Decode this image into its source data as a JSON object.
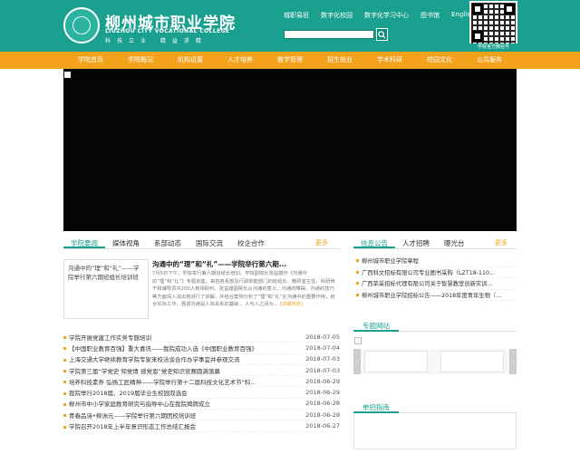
{
  "header": {
    "title_cn": "柳州城市职业学院",
    "title_en": "LIUZHOU CITY VOCATIONAL COLLEGE",
    "motto": "科技立业 精益求精",
    "top_links": [
      "城职易班",
      "数字化校园",
      "数字化学习中心",
      "图书馆",
      "English"
    ],
    "search": {
      "value": "",
      "placeholder": ""
    },
    "qr_caption": "学院官方微信号"
  },
  "nav": [
    "学院首页",
    "学院概况",
    "机构设置",
    "人才培养",
    "教学管理",
    "招生就业",
    "学术科研",
    "校园文化",
    "公共服务"
  ],
  "news_section": {
    "tabs": [
      "学院要闻",
      "媒体视角",
      "系部动态",
      "国际交流",
      "校企合作"
    ],
    "more": "更多",
    "featured": {
      "box_text": "沟通中的“理”和“礼”——学院举行第六期班组长培训班",
      "title": "沟通中的“理”和“礼”——学院举行第六期...",
      "body": "7月5日下午，学院举行第六期班组长培训，学院副院长张益雄作《沟通中的“理”和“礼”》专题讲座。来自各系部及行政职能部门的班组长、教研室主任、科研骨干和辅导员共200人到场聆听。张益雄副院长从沟通的意义、沟通的障碍、沟通的技巧等方面深入浅出地进行了讲解，并结合案例分析了“理”和“礼”在沟通中的重要作用，结合实际工作，强调沟通是人际关系的基础... 人与人之间为...",
      "detail_link": "[详细浏览]"
    },
    "items": [
      {
        "title": "学院开展党建工作实务专题培训",
        "date": "2018-07-05"
      },
      {
        "title": "【中国职业教育百强】重大喜讯——我院成功入选《中国职业教育百强》",
        "date": "2018-07-04"
      },
      {
        "title": "上海交通大学继续教育学院专家来校洽谈合作办学事宜并参观交流",
        "date": "2018-07-03"
      },
      {
        "title": "学院第三届“学党史 知党情 感党恩”党史知识竞赛圆满落幕",
        "date": "2018-07-03"
      },
      {
        "title": "培养科技素养 弘扬工匠精神——学院举行第十二届科技文化艺术节“科…",
        "date": "2018-06-29"
      },
      {
        "title": "我院举行2018届、2019届毕业生校园双选会",
        "date": "2018-06-29"
      },
      {
        "title": "柳州市中小学家庭教育研究与指导中心在我院揭牌成立",
        "date": "2018-06-28"
      },
      {
        "title": "青春品诗•柳洲元——学院举行第六期团校培训班",
        "date": "2018-06-28"
      },
      {
        "title": "学院召开2018年上半年意识形态工作总结汇报会",
        "date": "2018-06-27"
      }
    ]
  },
  "notice_section": {
    "tabs": [
      "信息公告",
      "人才招聘",
      "曝光台"
    ],
    "more": "更多",
    "items": [
      "柳州城市职业学院章程",
      "广西科文招标有限公司专业图书采购（LZT18-110...",
      "广西荣采招标代理有限公司关于智慧教室创新实训...",
      "柳州城市职业学院招标公告——2018年度青年生物（..."
    ]
  },
  "zhuanti": {
    "title": "专题网站",
    "prev": "‹",
    "next": "›"
  },
  "guide": {
    "title": "单招指南"
  },
  "colors": {
    "primary": "#1aa08e",
    "nav": "#f4a21b",
    "banner": "#050505"
  }
}
